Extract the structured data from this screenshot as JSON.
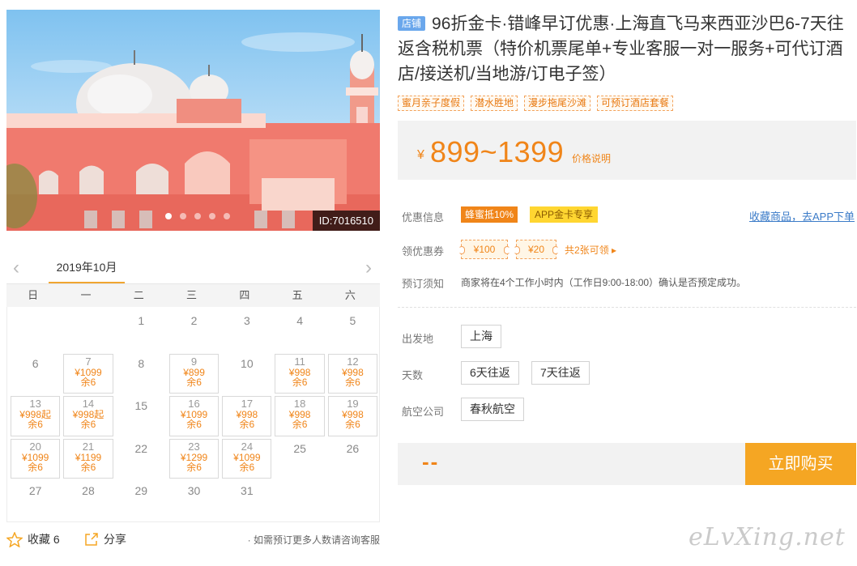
{
  "hero": {
    "id_label": "ID:7016510",
    "dot_count": 5,
    "active_dot": 0
  },
  "calendar": {
    "month_label": "2019年10月",
    "weekdays": [
      "日",
      "一",
      "二",
      "三",
      "四",
      "五",
      "六"
    ],
    "days": [
      {
        "d": ""
      },
      {
        "d": ""
      },
      {
        "d": "1"
      },
      {
        "d": "2"
      },
      {
        "d": "3"
      },
      {
        "d": "4"
      },
      {
        "d": "5"
      },
      {
        "d": "6"
      },
      {
        "d": "7",
        "price": "¥1099",
        "stock": "余6"
      },
      {
        "d": "8"
      },
      {
        "d": "9",
        "price": "¥899",
        "stock": "余6"
      },
      {
        "d": "10"
      },
      {
        "d": "11",
        "price": "¥998",
        "stock": "余6"
      },
      {
        "d": "12",
        "price": "¥998",
        "stock": "余6"
      },
      {
        "d": "13",
        "price": "¥998起",
        "stock": "余6"
      },
      {
        "d": "14",
        "price": "¥998起",
        "stock": "余6"
      },
      {
        "d": "15"
      },
      {
        "d": "16",
        "price": "¥1099",
        "stock": "余6"
      },
      {
        "d": "17",
        "price": "¥998",
        "stock": "余6"
      },
      {
        "d": "18",
        "price": "¥998",
        "stock": "余6"
      },
      {
        "d": "19",
        "price": "¥998",
        "stock": "余6"
      },
      {
        "d": "20",
        "price": "¥1099",
        "stock": "余6"
      },
      {
        "d": "21",
        "price": "¥1199",
        "stock": "余6"
      },
      {
        "d": "22"
      },
      {
        "d": "23",
        "price": "¥1299",
        "stock": "余6"
      },
      {
        "d": "24",
        "price": "¥1099",
        "stock": "余6"
      },
      {
        "d": "25"
      },
      {
        "d": "26"
      },
      {
        "d": "27"
      },
      {
        "d": "28"
      },
      {
        "d": "29"
      },
      {
        "d": "30"
      },
      {
        "d": "31"
      },
      {
        "d": ""
      },
      {
        "d": ""
      }
    ]
  },
  "footer": {
    "fav_label": "收藏 6",
    "share_label": "分享",
    "tip": "· 如需预订更多人数请咨询客服"
  },
  "product": {
    "badge": "店铺",
    "title": "96折金卡·错峰早订优惠·上海直飞马来西亚沙巴6-7天往返含税机票（特价机票尾单+专业客服一对一服务+可代订酒店/接送机/当地游/订电子签）",
    "tags": [
      "蜜月亲子度假",
      "潜水胜地",
      "漫步拖尾沙滩",
      "可预订酒店套餐"
    ]
  },
  "price": {
    "currency": "¥",
    "value": "899~1399",
    "note": "价格说明"
  },
  "promo": {
    "label": "优惠信息",
    "tag1": "蜂蜜抵10%",
    "tag2": "APP金卡专享",
    "app_link": "收藏商品，去APP下单"
  },
  "coupons": {
    "label": "领优惠券",
    "items": [
      "¥100",
      "¥20"
    ],
    "more": "共2张可领 ▸"
  },
  "booking_note": {
    "label": "预订须知",
    "text": "商家将在4个工作小时内（工作日9:00-18:00）确认是否预定成功。"
  },
  "options": {
    "departure": {
      "label": "出发地",
      "values": [
        "上海"
      ]
    },
    "days": {
      "label": "天数",
      "values": [
        "6天往返",
        "7天往返"
      ]
    },
    "airline": {
      "label": "航空公司",
      "values": [
        "春秋航空"
      ]
    }
  },
  "buy": {
    "total": "--",
    "button": "立即购买"
  },
  "watermark": "eLvXing.net",
  "colors": {
    "accent": "#f08519",
    "buy_button": "#f5a623",
    "link": "#3b7bc8"
  }
}
